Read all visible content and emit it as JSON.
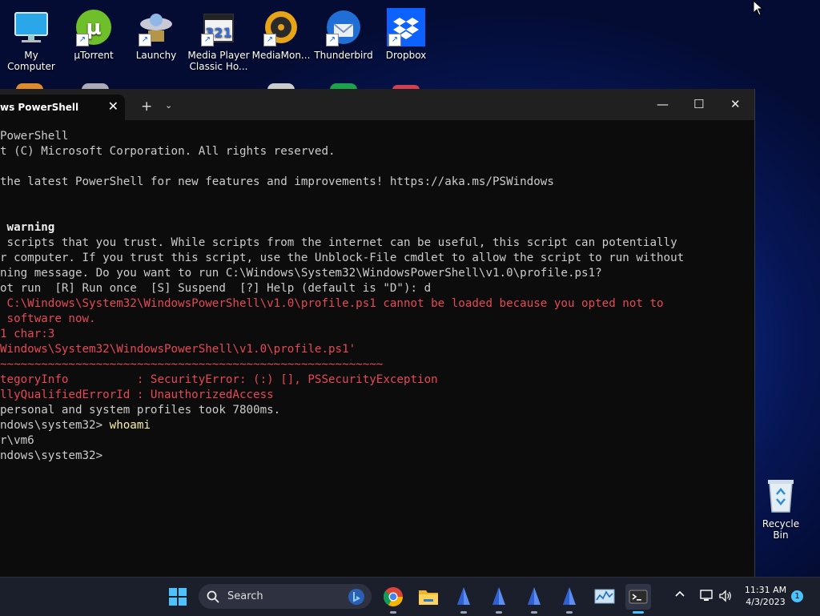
{
  "desktop": {
    "icons": [
      {
        "label": "My Computer",
        "icon": "monitor-icon"
      },
      {
        "label": "µTorrent",
        "icon": "utorrent-icon"
      },
      {
        "label": "Launchy",
        "icon": "launchy-icon"
      },
      {
        "label": "Media Player Classic Ho...",
        "icon": "mpc-icon",
        "icon_text": "321"
      },
      {
        "label": "MediaMon...",
        "icon": "mediamonkey-icon"
      },
      {
        "label": "Thunderbird",
        "icon": "thunderbird-icon"
      },
      {
        "label": "Dropbox",
        "icon": "dropbox-icon"
      }
    ],
    "recycle_bin": {
      "label": "Recycle Bin",
      "icon": "recycle-bin-icon"
    }
  },
  "terminal": {
    "tab_title": "ws PowerShell",
    "tab_close": "✕",
    "new_tab": "+",
    "dropdown": "⌄",
    "minimize": "—",
    "maximize": "☐",
    "close": "✕",
    "lines": [
      {
        "text": "PowerShell",
        "style": "normal"
      },
      {
        "text": "t (C) Microsoft Corporation. All rights reserved.",
        "style": "normal"
      },
      {
        "text": "",
        "style": "normal"
      },
      {
        "text": "the latest PowerShell for new features and improvements! https://aka.ms/PSWindows",
        "style": "normal"
      },
      {
        "text": "",
        "style": "normal"
      },
      {
        "text": "",
        "style": "normal"
      },
      {
        "text": " warning",
        "style": "bold"
      },
      {
        "text": " scripts that you trust. While scripts from the internet can be useful, this script can potentially",
        "style": "normal"
      },
      {
        "text": "r computer. If you trust this script, use the Unblock-File cmdlet to allow the script to run without",
        "style": "normal"
      },
      {
        "text": "ning message. Do you want to run C:\\Windows\\System32\\WindowsPowerShell\\v1.0\\profile.ps1?",
        "style": "normal"
      },
      {
        "text": "ot run  [R] Run once  [S] Suspend  [?] Help (default is \"D\"): d",
        "style": "normal"
      },
      {
        "text": " C:\\Windows\\System32\\WindowsPowerShell\\v1.0\\profile.ps1 cannot be loaded because you opted not to",
        "style": "err"
      },
      {
        "text": " software now.",
        "style": "err"
      },
      {
        "text": "1 char:3",
        "style": "err"
      },
      {
        "text": "Windows\\System32\\WindowsPowerShell\\v1.0\\profile.ps1'",
        "style": "err"
      },
      {
        "text": "~~~~~~~~~~~~~~~~~~~~~~~~~~~~~~~~~~~~~~~~~~~~~~~~~~~~~~~~",
        "style": "err"
      },
      {
        "text": "tegoryInfo          : SecurityError: (:) [], PSSecurityException",
        "style": "err"
      },
      {
        "text": "llyQualifiedErrorId : UnauthorizedAccess",
        "style": "err"
      },
      {
        "text": "personal and system profiles took 7800ms.",
        "style": "normal"
      },
      {
        "text": "ndows\\system32> ",
        "style": "normal",
        "command": "whoami"
      },
      {
        "text": "r\\vm6",
        "style": "normal"
      },
      {
        "text": "ndows\\system32>",
        "style": "normal"
      }
    ]
  },
  "taskbar": {
    "search_placeholder": "Search",
    "apps": [
      {
        "name": "chrome-icon"
      },
      {
        "name": "file-explorer-icon"
      },
      {
        "name": "app-sail-icon-1"
      },
      {
        "name": "app-sail-icon-2"
      },
      {
        "name": "app-sail-icon-3"
      },
      {
        "name": "app-sail-icon-4"
      },
      {
        "name": "task-manager-icon"
      },
      {
        "name": "terminal-icon",
        "active": true
      }
    ],
    "clock_time": "11:31 AM",
    "clock_date": "4/3/2023",
    "notification_count": "1"
  }
}
